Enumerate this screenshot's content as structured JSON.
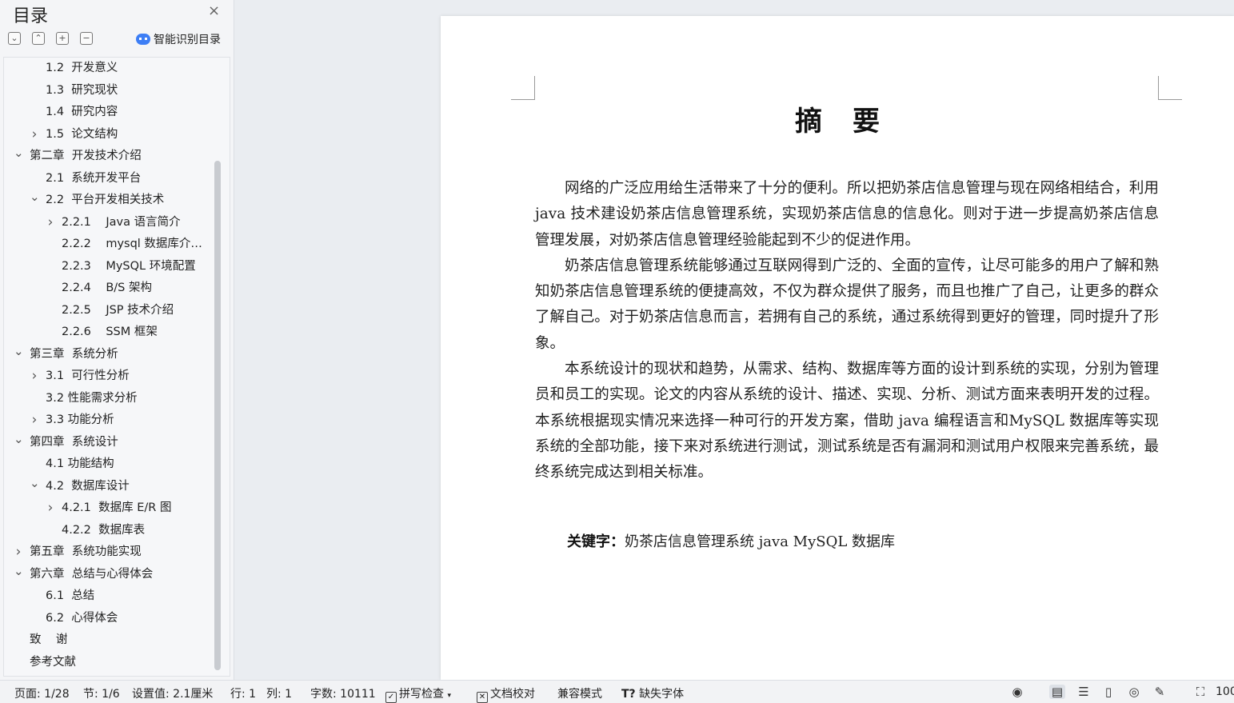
{
  "sidebar": {
    "title": "目录",
    "close_icon": "×",
    "tools": [
      "⌄",
      "⌃",
      "+",
      "−"
    ],
    "smart_label": "智能识别目录",
    "toc": [
      {
        "label": "1.2  开发意义",
        "level": 2,
        "chevron": ""
      },
      {
        "label": "1.3  研究现状",
        "level": 2,
        "chevron": ""
      },
      {
        "label": "1.4  研究内容",
        "level": 2,
        "chevron": ""
      },
      {
        "label": "1.5  论文结构",
        "level": 2,
        "chevron": ">"
      },
      {
        "label": "第二章  开发技术介绍",
        "level": 1,
        "chevron": "v"
      },
      {
        "label": "2.1  系统开发平台",
        "level": 2,
        "chevron": ""
      },
      {
        "label": "2.2  平台开发相关技术",
        "level": 2,
        "chevron": "v"
      },
      {
        "label": "2.2.1    Java 语言简介",
        "level": 3,
        "chevron": ">"
      },
      {
        "label": "2.2.2    mysql 数据库介…",
        "level": 3,
        "chevron": ""
      },
      {
        "label": "2.2.3    MySQL 环境配置",
        "level": 3,
        "chevron": ""
      },
      {
        "label": "2.2.4    B/S 架构",
        "level": 3,
        "chevron": ""
      },
      {
        "label": "2.2.5    JSP 技术介绍",
        "level": 3,
        "chevron": ""
      },
      {
        "label": "2.2.6    SSM 框架",
        "level": 3,
        "chevron": ""
      },
      {
        "label": "第三章  系统分析",
        "level": 1,
        "chevron": "v"
      },
      {
        "label": "3.1  可行性分析",
        "level": 2,
        "chevron": ">"
      },
      {
        "label": "3.2 性能需求分析",
        "level": 2,
        "chevron": ""
      },
      {
        "label": "3.3 功能分析",
        "level": 2,
        "chevron": ">"
      },
      {
        "label": "第四章  系统设计",
        "level": 1,
        "chevron": "v"
      },
      {
        "label": "4.1 功能结构",
        "level": 2,
        "chevron": ""
      },
      {
        "label": "4.2  数据库设计",
        "level": 2,
        "chevron": "v"
      },
      {
        "label": "4.2.1  数据库 E/R 图",
        "level": 3,
        "chevron": ">"
      },
      {
        "label": "4.2.2  数据库表",
        "level": 3,
        "chevron": ""
      },
      {
        "label": "第五章  系统功能实现",
        "level": 1,
        "chevron": ">"
      },
      {
        "label": "第六章  总结与心得体会",
        "level": 1,
        "chevron": "v"
      },
      {
        "label": "6.1  总结",
        "level": 2,
        "chevron": ""
      },
      {
        "label": "6.2  心得体会",
        "level": 2,
        "chevron": ""
      },
      {
        "label": "致    谢",
        "level": 1,
        "chevron": ""
      },
      {
        "label": "参考文献",
        "level": 1,
        "chevron": ""
      }
    ]
  },
  "document": {
    "title": "摘要",
    "paragraphs": [
      "网络的广泛应用给生活带来了十分的便利。所以把奶茶店信息管理与现在网络相结合，利用 java 技术建设奶茶店信息管理系统，实现奶茶店信息的信息化。则对于进一步提高奶茶店信息管理发展，对奶茶店信息管理经验能起到不少的促进作用。",
      "奶茶店信息管理系统能够通过互联网得到广泛的、全面的宣传，让尽可能多的用户了解和熟知奶茶店信息管理系统的便捷高效，不仅为群众提供了服务，而且也推广了自己，让更多的群众了解自己。对于奶茶店信息而言，若拥有自己的系统，通过系统得到更好的管理，同时提升了形象。",
      "本系统设计的现状和趋势，从需求、结构、数据库等方面的设计到系统的实现，分别为管理员和员工的实现。论文的内容从系统的设计、描述、实现、分析、测试方面来表明开发的过程。本系统根据现实情况来选择一种可行的开发方案，借助 java 编程语言和MySQL 数据库等实现系统的全部功能，接下来对系统进行测试，测试系统是否有漏洞和测试用户权限来完善系统，最终系统完成达到相关标准。"
    ],
    "keywords_label": "关键字：",
    "keywords_value": "奶茶店信息管理系统  java  MySQL 数据库"
  },
  "statusbar": {
    "page": "页面: 1/28",
    "section": "节: 1/6",
    "setting": "设置值: 2.1厘米",
    "row": "行: 1",
    "col": "列: 1",
    "words": "字数: 10111",
    "spell": "拼写检查",
    "proof": "文档校对",
    "compat": "兼容模式",
    "missing_font": "缺失字体",
    "zoom": "100"
  }
}
